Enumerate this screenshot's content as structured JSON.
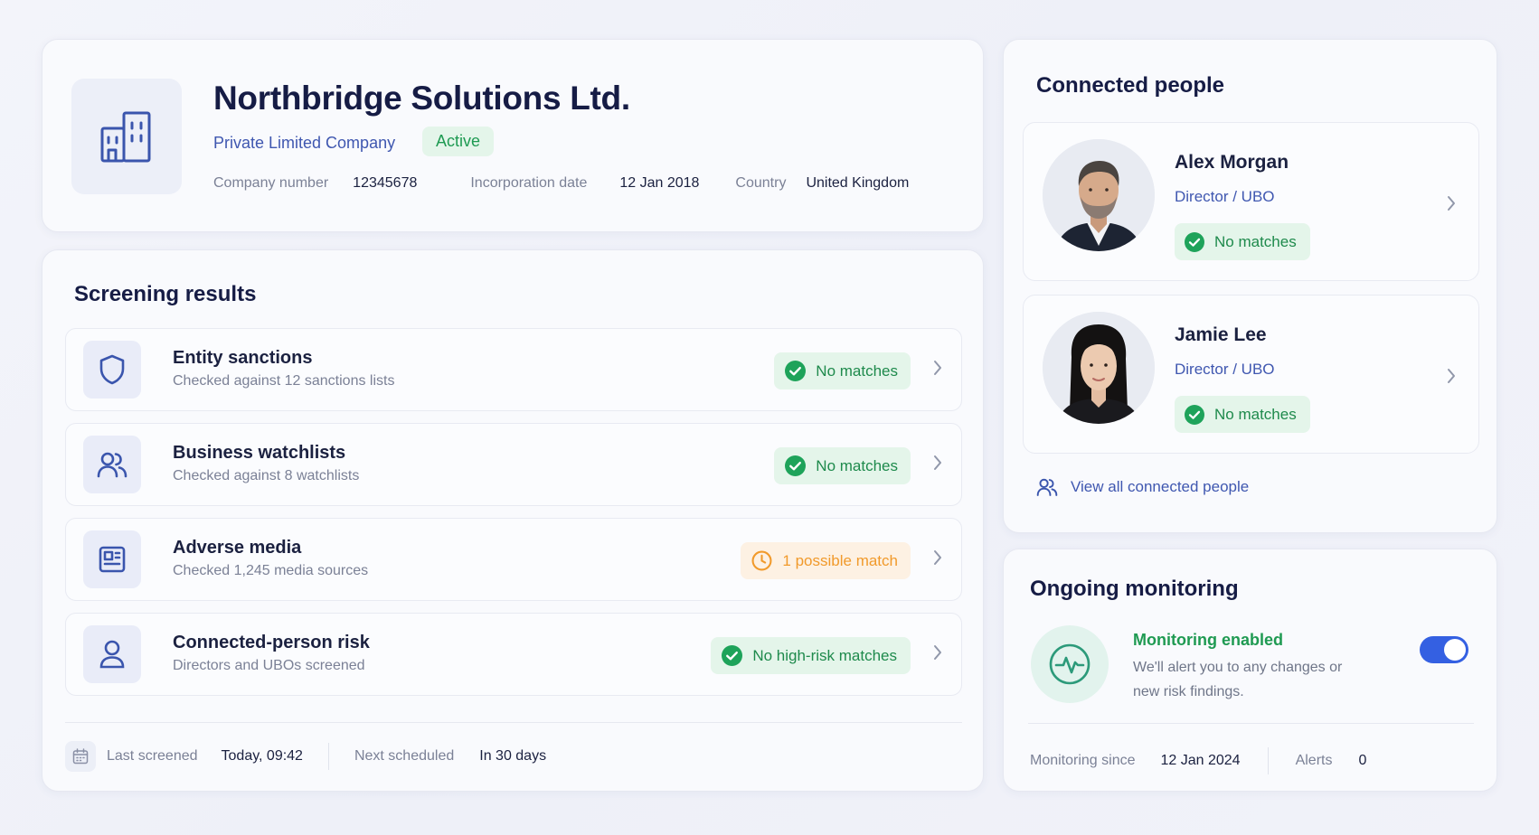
{
  "company": {
    "name": "Northbridge Solutions Ltd.",
    "type": "Private Limited Company",
    "status": "Active",
    "meta": {
      "number_label": "Company number",
      "number_value": "12345678",
      "inc_label": "Incorporation date",
      "inc_value": "12 Jan 2018",
      "country_label": "Country",
      "country_value": "United Kingdom"
    }
  },
  "screening": {
    "title": "Screening results",
    "checks": [
      {
        "title": "Entity sanctions",
        "subtitle": "Checked against 12 sanctions lists",
        "result": "No matches",
        "status": "ok",
        "icon": "shield-icon"
      },
      {
        "title": "Business watchlists",
        "subtitle": "Checked against 8 watchlists",
        "result": "No matches",
        "status": "ok",
        "icon": "users-icon"
      },
      {
        "title": "Adverse media",
        "subtitle": "Checked 1,245 media sources",
        "result": "1 possible match",
        "status": "warning",
        "icon": "newspaper-icon"
      },
      {
        "title": "Connected-person risk",
        "subtitle": "Directors and UBOs screened",
        "result": "No high-risk matches",
        "status": "ok",
        "icon": "person-icon"
      }
    ],
    "footer": {
      "last_label": "Last screened",
      "last_value": "Today, 09:42",
      "next_label": "Next scheduled",
      "next_value": "In 30 days"
    }
  },
  "people": {
    "title": "Connected people",
    "list": [
      {
        "name": "Alex Morgan",
        "role": "Director / UBO",
        "result": "No matches"
      },
      {
        "name": "Jamie Lee",
        "role": "Director / UBO",
        "result": "No matches"
      }
    ],
    "view_all": "View all connected people"
  },
  "monitoring": {
    "title": "Ongoing monitoring",
    "status_title": "Monitoring enabled",
    "description": "We'll alert you to any changes or new risk findings.",
    "enabled": true,
    "since_label": "Monitoring since",
    "since_value": "12 Jan 2024",
    "alerts_label": "Alerts",
    "alerts_value": "0"
  },
  "colors": {
    "accent": "#3460e2",
    "success": "#1e9a52",
    "warning": "#f19a2b",
    "title": "#161c45"
  }
}
